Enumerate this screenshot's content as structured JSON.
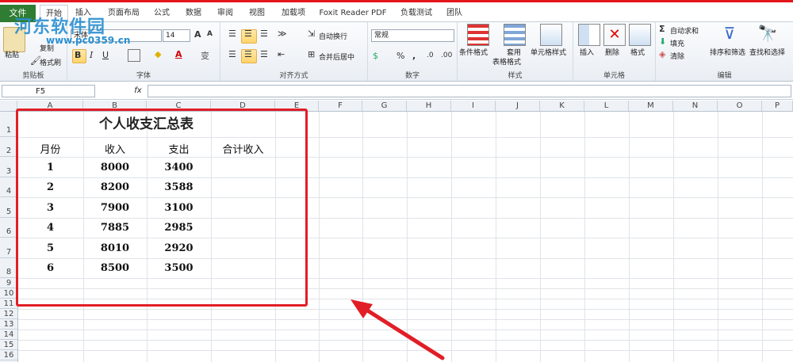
{
  "ribbon": {
    "tabs": [
      "文件",
      "开始",
      "插入",
      "页面布局",
      "公式",
      "数据",
      "审阅",
      "视图",
      "加载项",
      "Foxit Reader PDF",
      "负载测试",
      "团队"
    ],
    "clipboard": {
      "paste": "粘贴",
      "copy": "复制",
      "format_painter": "格式刷",
      "label": "剪贴板"
    },
    "font": {
      "name": "宋体",
      "size": "14",
      "label": "字体",
      "bold": "B",
      "italic": "I",
      "underline": "U",
      "grow": "A",
      "shrink": "A",
      "wen": "变"
    },
    "align": {
      "wrap": "自动换行",
      "merge": "合并后居中",
      "label": "对齐方式"
    },
    "number": {
      "format": "常规",
      "percent": "%",
      "comma": ",",
      "label": "数字"
    },
    "styles": {
      "conditional": "条件格式",
      "table": "套用\n表格格式",
      "table_line1": "套用",
      "table_line2": "表格格式",
      "cell_styles": "单元格样式",
      "label": "样式"
    },
    "cells": {
      "insert": "插入",
      "delete": "删除",
      "format": "格式",
      "label": "单元格"
    },
    "editing": {
      "autosum": "自动求和",
      "fill": "填充",
      "clear": "清除",
      "sort": "排序和筛选",
      "find": "查找和选择",
      "label": "编辑"
    }
  },
  "watermark": {
    "line1": "河东软件园",
    "line2": "www.pc0359.cn"
  },
  "formula_bar": {
    "name_box": "F5",
    "fx": "fx",
    "content": ""
  },
  "columns": [
    "A",
    "B",
    "C",
    "D",
    "E",
    "F",
    "G",
    "H",
    "I",
    "J",
    "K",
    "L",
    "M",
    "N",
    "O",
    "P"
  ],
  "rows": [
    "1",
    "2",
    "3",
    "4",
    "5",
    "6",
    "7",
    "8",
    "9",
    "10",
    "11",
    "12",
    "13",
    "14",
    "15",
    "16"
  ],
  "sheet": {
    "title": "个人收支汇总表",
    "headers": [
      "月份",
      "收入",
      "支出",
      "合计收入"
    ],
    "data": [
      [
        "1",
        "8000",
        "3400",
        ""
      ],
      [
        "2",
        "8200",
        "3588",
        ""
      ],
      [
        "3",
        "7900",
        "3100",
        ""
      ],
      [
        "4",
        "7885",
        "2985",
        ""
      ],
      [
        "5",
        "8010",
        "2920",
        ""
      ],
      [
        "6",
        "8500",
        "3500",
        ""
      ]
    ]
  },
  "colors": {
    "annotation": "#e11e26",
    "file_tab": "#2e7d32",
    "top_accent": "#e4151b"
  }
}
